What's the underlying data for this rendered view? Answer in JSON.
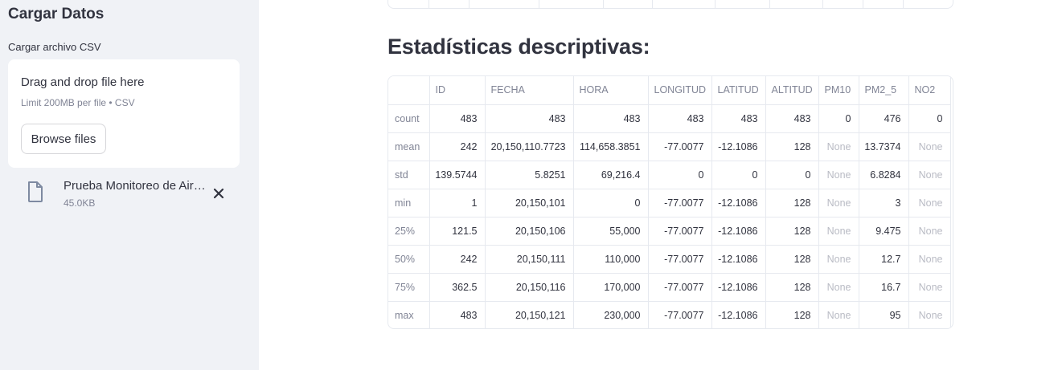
{
  "sidebar": {
    "title": "Cargar Datos",
    "uploader_label": "Cargar archivo CSV",
    "dropzone": {
      "title": "Drag and drop file here",
      "limit": "Limit 200MB per file • CSV",
      "browse_label": "Browse files"
    },
    "file": {
      "name": "Prueba Monitoreo de Aire.csv",
      "size": "45.0KB"
    }
  },
  "main": {
    "heading": "Estadísticas descriptivas:",
    "table": {
      "columns": [
        "",
        "ID",
        "FECHA",
        "HORA",
        "LONGITUD",
        "LATITUD",
        "ALTITUD",
        "PM10",
        "PM2_5",
        "NO2"
      ],
      "rows": [
        [
          "count",
          "483",
          "483",
          "483",
          "483",
          "483",
          "483",
          "0",
          "476",
          "0"
        ],
        [
          "mean",
          "242",
          "20,150,110.7723",
          "114,658.3851",
          "-77.0077",
          "-12.1086",
          "128",
          "None",
          "13.7374",
          "None"
        ],
        [
          "std",
          "139.5744",
          "5.8251",
          "69,216.4",
          "0",
          "0",
          "0",
          "None",
          "6.8284",
          "None"
        ],
        [
          "min",
          "1",
          "20,150,101",
          "0",
          "-77.0077",
          "-12.1086",
          "128",
          "None",
          "3",
          "None"
        ],
        [
          "25%",
          "121.5",
          "20,150,106",
          "55,000",
          "-77.0077",
          "-12.1086",
          "128",
          "None",
          "9.475",
          "None"
        ],
        [
          "50%",
          "242",
          "20,150,111",
          "110,000",
          "-77.0077",
          "-12.1086",
          "128",
          "None",
          "12.7",
          "None"
        ],
        [
          "75%",
          "362.5",
          "20,150,116",
          "170,000",
          "-77.0077",
          "-12.1086",
          "128",
          "None",
          "16.7",
          "None"
        ],
        [
          "max",
          "483",
          "20,150,121",
          "230,000",
          "-77.0077",
          "-12.1086",
          "128",
          "None",
          "95",
          "None"
        ]
      ]
    }
  },
  "icons": {
    "file": "file-icon",
    "close": "close-icon"
  },
  "colors": {
    "sidebar_bg": "#f0f2f6",
    "text": "#31333f",
    "muted": "#808495",
    "border": "#e6e9ef"
  }
}
